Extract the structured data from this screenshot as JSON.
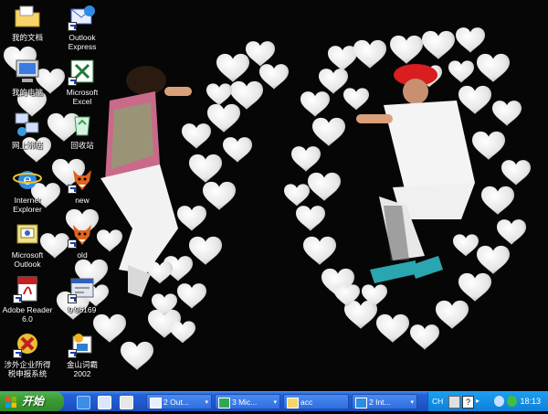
{
  "desktop": {
    "icons": [
      {
        "id": "my-documents",
        "label": "我的文档",
        "icon": "folder-icon",
        "shortcut": false
      },
      {
        "id": "outlook-express",
        "label": "Outlook\nExpress",
        "icon": "outlook-express-icon",
        "shortcut": true
      },
      {
        "id": "my-computer",
        "label": "我的电脑",
        "icon": "computer-icon",
        "shortcut": false
      },
      {
        "id": "microsoft-excel",
        "label": "Microsoft\nExcel",
        "icon": "excel-icon",
        "shortcut": true
      },
      {
        "id": "network",
        "label": "网上邻居",
        "icon": "network-icon",
        "shortcut": false
      },
      {
        "id": "recycle-bin",
        "label": "回收站",
        "icon": "recycle-bin-icon",
        "shortcut": false
      },
      {
        "id": "internet-explorer",
        "label": "Internet\nExplorer",
        "icon": "ie-icon",
        "shortcut": false
      },
      {
        "id": "new-fox",
        "label": "new",
        "icon": "fox-icon",
        "shortcut": true
      },
      {
        "id": "microsoft-outlook",
        "label": "Microsoft\nOutlook",
        "icon": "outlook-icon",
        "shortcut": false
      },
      {
        "id": "old-fox",
        "label": "old",
        "icon": "fox-icon",
        "shortcut": true
      },
      {
        "id": "adobe-reader",
        "label": "Adobe Reader\n6.0",
        "icon": "adobe-reader-icon",
        "shortcut": true
      },
      {
        "id": "file-96169",
        "label": "9 96169",
        "icon": "program-icon",
        "shortcut": true
      },
      {
        "id": "tax-system",
        "label": "涉外企业所得\n税申报系统",
        "icon": "tax-app-icon",
        "shortcut": true
      },
      {
        "id": "kingsoft-ciba",
        "label": "金山词霸\n2002",
        "icon": "kingsoft-icon",
        "shortcut": true
      }
    ]
  },
  "taskbar": {
    "start_label": "开始",
    "tasks": [
      {
        "label": "2 Out...",
        "icon": "outlook-task-icon",
        "arrow": "▾"
      },
      {
        "label": "3 Mic...",
        "icon": "excel-task-icon",
        "arrow": "▾"
      },
      {
        "label": "acc",
        "icon": "folder-task-icon",
        "arrow": ""
      },
      {
        "label": "2 Int...",
        "icon": "ie-task-icon",
        "arrow": "▾"
      }
    ],
    "tray": {
      "lang": "CH",
      "clock": "18:13"
    }
  },
  "colors": {
    "taskbar": "#2057cc",
    "start": "#3b9b36",
    "tray": "#0f7fd8",
    "desktop": "#050505"
  }
}
